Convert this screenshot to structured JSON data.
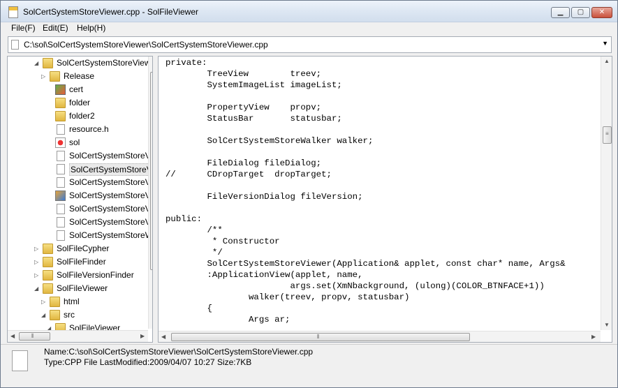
{
  "window": {
    "title": "SolCertSystemStoreViewer.cpp - SolFileViewer",
    "minimize": "▁",
    "maximize": "▢",
    "close": "✕"
  },
  "menu": {
    "file": "File(F)",
    "edit": "Edit(E)",
    "help": "Help(H)"
  },
  "address": {
    "path": "C:\\sol\\SolCertSystemStoreViewer\\SolCertSystemStoreViewer.cpp",
    "dropdown_icon": "chevron-down-icon"
  },
  "tree": {
    "items": [
      {
        "label": "SolCertSystemStoreViewer",
        "icon": "folder-open-icon",
        "arrow": "◢"
      },
      {
        "label": "Release",
        "icon": "folder-icon",
        "arrow": "▷"
      },
      {
        "label": "cert",
        "icon": "image-file-icon",
        "arrow": ""
      },
      {
        "label": "folder",
        "icon": "folder-icon",
        "arrow": ""
      },
      {
        "label": "folder2",
        "icon": "folder-icon",
        "arrow": ""
      },
      {
        "label": "resource.h",
        "icon": "file-icon",
        "arrow": ""
      },
      {
        "label": "sol",
        "icon": "icon-file-icon",
        "arrow": ""
      },
      {
        "label": "SolCertSystemStoreV",
        "icon": "file-icon",
        "arrow": ""
      },
      {
        "label": "SolCertSystemStoreV",
        "icon": "file-icon",
        "arrow": "",
        "selected": true
      },
      {
        "label": "SolCertSystemStoreV",
        "icon": "file-icon",
        "arrow": ""
      },
      {
        "label": "SolCertSystemStoreV",
        "icon": "project-file-icon",
        "arrow": ""
      },
      {
        "label": "SolCertSystemStoreV",
        "icon": "file-icon",
        "arrow": ""
      },
      {
        "label": "SolCertSystemStoreV",
        "icon": "file-icon",
        "arrow": ""
      },
      {
        "label": "SolCertSystemStoreW",
        "icon": "file-icon",
        "arrow": ""
      },
      {
        "label": "SolFileCypher",
        "icon": "folder-icon",
        "arrow": "▷"
      },
      {
        "label": "SolFileFinder",
        "icon": "folder-icon",
        "arrow": "▷"
      },
      {
        "label": "SolFileVersionFinder",
        "icon": "folder-icon",
        "arrow": "▷"
      },
      {
        "label": "SolFileViewer",
        "icon": "folder-open-icon",
        "arrow": "◢"
      },
      {
        "label": "html",
        "icon": "folder-icon",
        "arrow": "▷"
      },
      {
        "label": "src",
        "icon": "folder-open-icon",
        "arrow": "◢"
      },
      {
        "label": "SolFileViewer",
        "icon": "folder-open-icon",
        "arrow": "◢"
      }
    ]
  },
  "code": {
    "lines": [
      "private:",
      "        TreeView        treev;",
      "        SystemImageList imageList;",
      "",
      "        PropertyView    propv;",
      "        StatusBar       statusbar;",
      "",
      "        SolCertSystemStoreWalker walker;",
      "",
      "        FileDialog fileDialog;",
      "//      CDropTarget  dropTarget;",
      "",
      "        FileVersionDialog fileVersion;",
      "",
      "public:",
      "        /**",
      "         * Constructor",
      "         */",
      "        SolCertSystemStoreViewer(Application& applet, const char* name, Args&",
      "        :ApplicationView(applet, name,",
      "                        args.set(XmNbackground, (ulong)(COLOR_BTNFACE+1))",
      "                walker(treev, propv, statusbar)",
      "        {",
      "                Args ar;"
    ]
  },
  "status": {
    "name_line": "Name:C:\\sol\\SolCertSystemStoreViewer\\SolCertSystemStoreViewer.cpp",
    "info_line": "Type:CPP File  LastModified:2009/04/07 10:27  Size:7KB"
  }
}
